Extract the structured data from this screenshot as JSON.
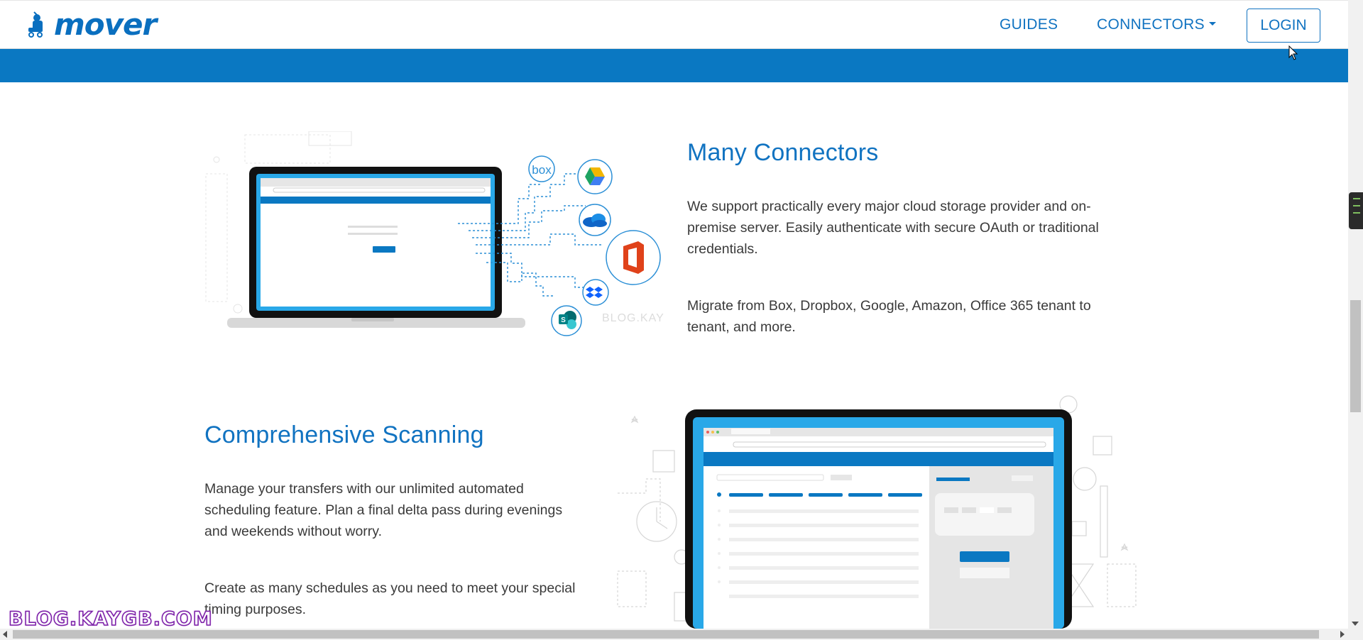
{
  "header": {
    "logo_text": "mover",
    "nav": {
      "guides": "GUIDES",
      "connectors": "CONNECTORS",
      "login": "LOGIN"
    }
  },
  "colors": {
    "brand_blue": "#1173c1",
    "band_blue": "#0a78c2"
  },
  "sections": {
    "connectors": {
      "title": "Many Connectors",
      "paragraph1": "We support practically every major cloud storage provider and on-premise server. Easily authenticate with secure OAuth or traditional credentials.",
      "paragraph2": "Migrate from Box, Dropbox, Google, Amazon, Office 365 tenant to tenant, and more.",
      "illustration_icons": [
        "box-icon",
        "google-drive-icon",
        "onedrive-icon",
        "office-icon",
        "dropbox-icon",
        "sharepoint-icon"
      ],
      "box_label": "box",
      "sharepoint_label": "S"
    },
    "scanning": {
      "title": "Comprehensive Scanning",
      "paragraph1": "Manage your transfers with our unlimited automated scheduling feature. Plan a final delta pass during evenings and weekends without worry.",
      "paragraph2": "Create as many schedules as you need to meet your special timing purposes."
    }
  },
  "watermark": "BLOG.KAYGB.COM",
  "illustration_watermark": "BLOG.KAYGB.COM"
}
